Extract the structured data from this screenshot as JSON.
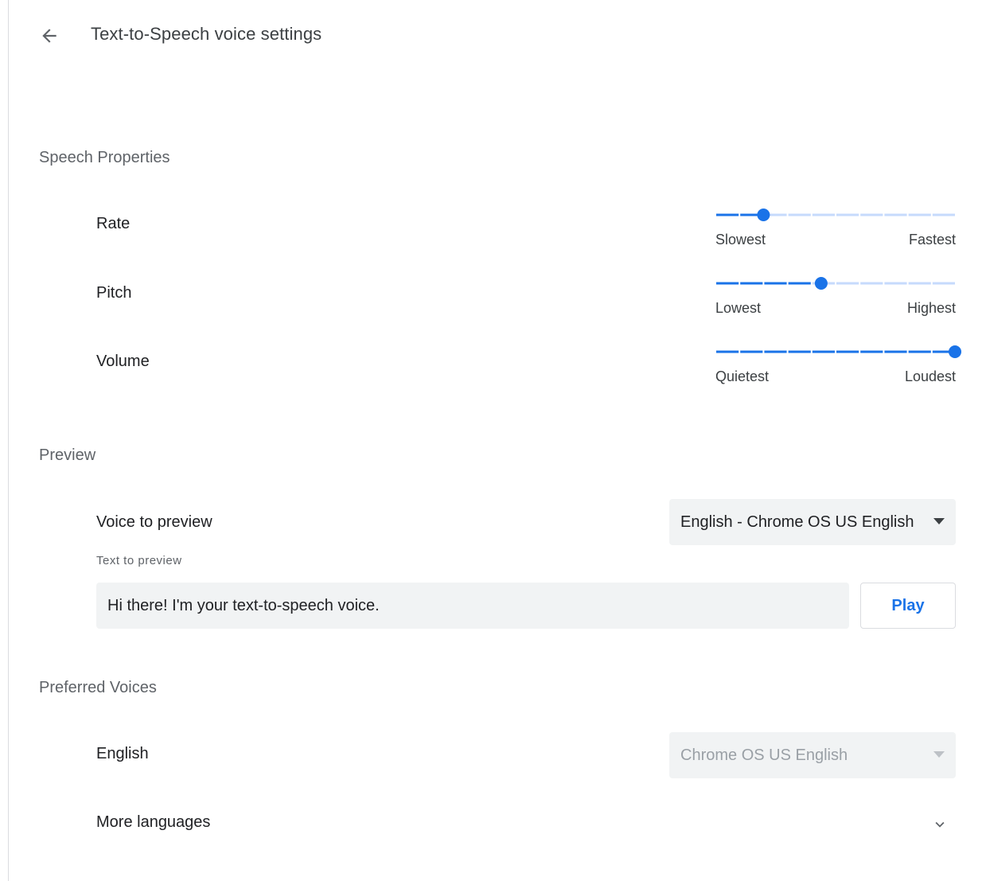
{
  "header": {
    "title": "Text-to-Speech voice settings",
    "back_icon": "arrow-left-icon"
  },
  "colors": {
    "accent": "#1a73e8",
    "track_inactive": "#c6dafc",
    "muted_text": "#5f6368",
    "disabled_text": "#9aa0a6",
    "field_bg": "#f1f3f4"
  },
  "speech_properties": {
    "title": "Speech Properties",
    "sliders": [
      {
        "label": "Rate",
        "min_label": "Slowest",
        "max_label": "Fastest",
        "steps": 10,
        "value_fraction": 0.2
      },
      {
        "label": "Pitch",
        "min_label": "Lowest",
        "max_label": "Highest",
        "steps": 10,
        "value_fraction": 0.44
      },
      {
        "label": "Volume",
        "min_label": "Quietest",
        "max_label": "Loudest",
        "steps": 10,
        "value_fraction": 1.0
      }
    ]
  },
  "preview": {
    "title": "Preview",
    "voice_label": "Voice to preview",
    "voice_value": "English - Chrome OS US English",
    "text_label": "Text to preview",
    "text_value": "Hi there! I'm your text-to-speech voice.",
    "play_label": "Play"
  },
  "preferred_voices": {
    "title": "Preferred Voices",
    "language_label": "English",
    "language_value": "Chrome OS US English",
    "more_label": "More languages"
  }
}
